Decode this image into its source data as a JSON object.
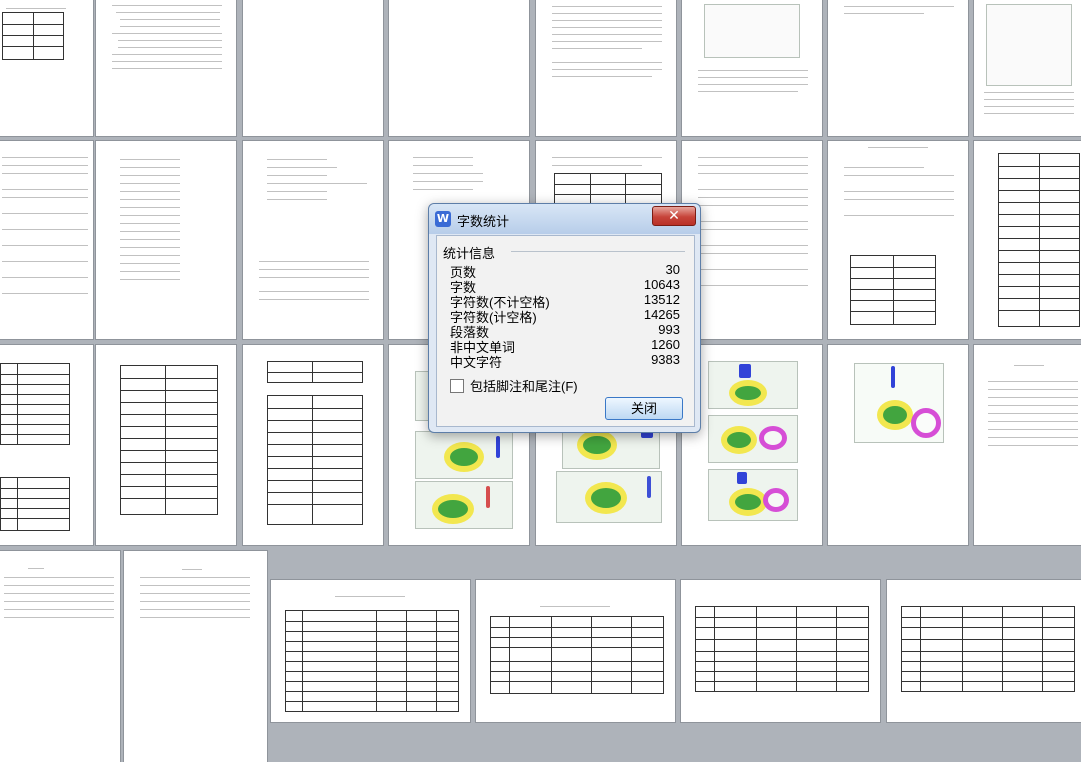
{
  "dialog": {
    "title": "字数统计",
    "close_icon": "close-icon",
    "section_title": "统计信息",
    "stats": [
      {
        "label": "页数",
        "value": "30"
      },
      {
        "label": "字数",
        "value": "10643"
      },
      {
        "label": "字符数(不计空格)",
        "value": "13512"
      },
      {
        "label": "字符数(计空格)",
        "value": "14265"
      },
      {
        "label": "段落数",
        "value": "993"
      },
      {
        "label": "非中文单词",
        "value": "1260"
      },
      {
        "label": "中文字符",
        "value": "9383"
      }
    ],
    "checkbox_label": "包括脚注和尾注(F)",
    "button_label": "关闭"
  },
  "colors": {
    "accent": "#3a6bd5",
    "close_red": "#c7443a",
    "green_part": "#42a53f",
    "yellow_edge": "#f2e74f",
    "magenta_hole": "#d64ed6"
  }
}
